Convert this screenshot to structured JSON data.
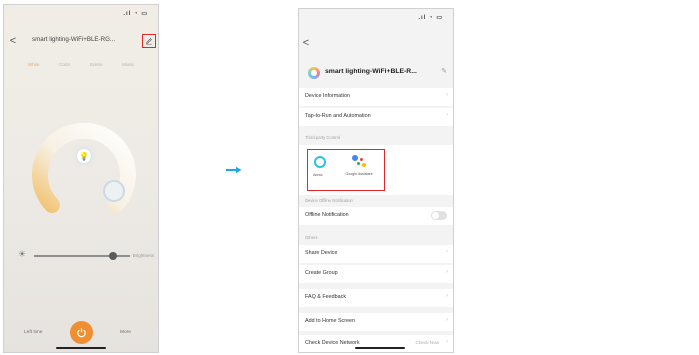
{
  "phone1": {
    "header": {
      "back": "<",
      "title": "smart lighting-WiFi+BLE-RG..."
    },
    "tabs": [
      {
        "label": "White"
      },
      {
        "label": "Color"
      },
      {
        "label": "Scene"
      },
      {
        "label": "Music"
      }
    ],
    "brightness_label": "Brightness",
    "brightness_level": 0.85,
    "bottom": {
      "left": "Left time",
      "right": "More"
    },
    "colors": {
      "accent": "#f08e32",
      "highlight": "#e02828"
    }
  },
  "phone2": {
    "back": "<",
    "device_title": "smart lighting-WiFi+BLE-R...",
    "rows_top": [
      {
        "label": "Device Information"
      },
      {
        "label": "Tap-to-Run and Automation"
      }
    ],
    "third_party_label": "Third-party Control",
    "third_party": [
      {
        "label": "Alexa"
      },
      {
        "label": "Google Assistant"
      }
    ],
    "offline_section": "Device Offline Notification",
    "offline_row": "Offline Notification",
    "others_label": "Others",
    "rows_bottom": [
      {
        "label": "Share Device"
      },
      {
        "label": "Create Group"
      },
      {
        "label": "FAQ & Feedback"
      },
      {
        "label": "Add to Home Screen"
      },
      {
        "label": "Check Device Network",
        "value": "Check Now"
      }
    ]
  },
  "arrow_color": "#21a7e8"
}
